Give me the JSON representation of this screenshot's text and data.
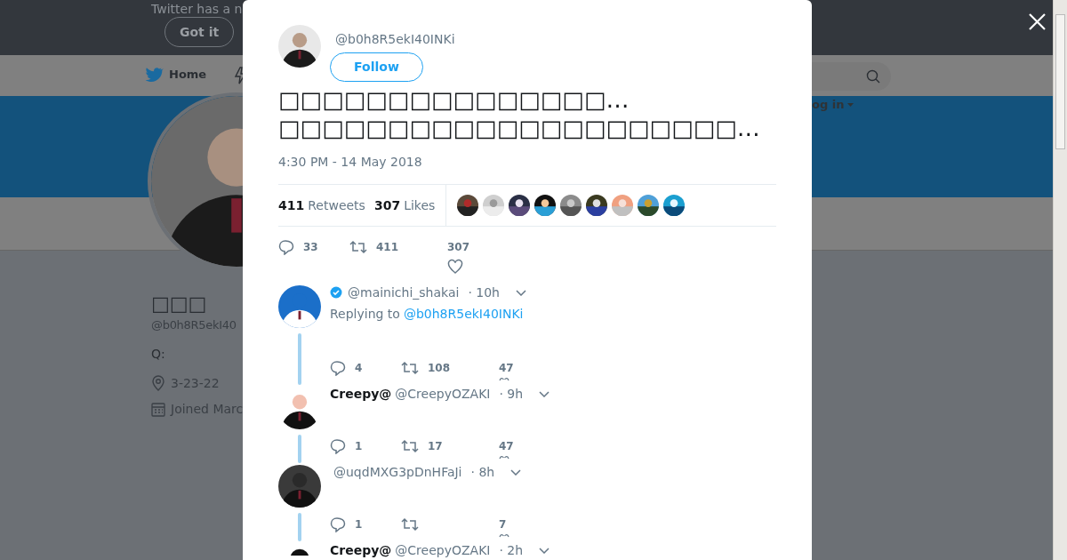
{
  "background": {
    "notice": "Twitter has a n",
    "got_it": "Got it",
    "nav_home": "Home",
    "login": "og in",
    "profile": {
      "name": "□□□",
      "handle": "@b0h8R5ekI40",
      "bio": "Q:",
      "location": "3-23-22",
      "joined": "Joined Marc"
    }
  },
  "tweet": {
    "handle": "@b0h8R5ekI40INKi",
    "follow": "Follow",
    "text_lines": [
      "□□□□□□□□□□□□□□□…",
      "□□□□□□□□□□□□□□□□□□□□□…"
    ],
    "time": "4:30 PM - 14 May 2018",
    "retweets": {
      "count": "411",
      "label": "Retweets"
    },
    "likes": {
      "count": "307",
      "label": "Likes"
    },
    "actions": {
      "reply": "33",
      "retweet": "411",
      "like": "307"
    }
  },
  "replies": [
    {
      "verified": true,
      "handle": "@mainichi_shakai",
      "time": "· 10h",
      "replying_label": "Replying to",
      "replying_to": "@b0h8R5ekI40INKi",
      "actions": {
        "reply": "4",
        "retweet": "108",
        "like": "47"
      }
    },
    {
      "verified": false,
      "name": "Creepy@",
      "handle": "@CreepyOZAKI",
      "time": "· 9h",
      "actions": {
        "reply": "1",
        "retweet": "17",
        "like": "47"
      }
    },
    {
      "verified": false,
      "handle": "@uqdMXG3pDnHFaJi",
      "time": "· 8h",
      "actions": {
        "reply": "1",
        "like": "7"
      }
    },
    {
      "verified": false,
      "name": "Creepy@",
      "handle": "@CreepyOZAKI",
      "time": "· 2h"
    }
  ]
}
